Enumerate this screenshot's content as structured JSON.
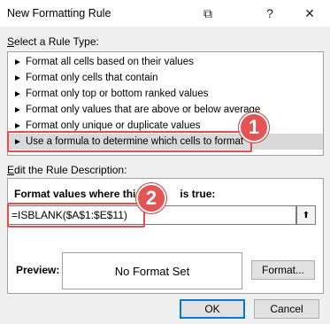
{
  "window": {
    "title": "New Formatting Rule",
    "controls": {
      "restore": "⧉",
      "help": "?",
      "close": "✕"
    }
  },
  "rule_type": {
    "label_prefix": "",
    "label_hot": "S",
    "label_rest": "elect a Rule Type:",
    "items": [
      {
        "label": "Format all cells based on their values",
        "selected": false
      },
      {
        "label": "Format only cells that contain",
        "selected": false
      },
      {
        "label": "Format only top or bottom ranked values",
        "selected": false
      },
      {
        "label": "Format only values that are above or below average",
        "selected": false
      },
      {
        "label": "Format only unique or duplicate values",
        "selected": false
      },
      {
        "label": "Use a formula to determine which cells to format",
        "selected": true
      }
    ],
    "arrow_glyph": "►"
  },
  "description": {
    "label_hot": "E",
    "label_rest": "dit the Rule Description:",
    "formula_heading": "Format values where this formula is true:",
    "formula_heading_visible": "Format values where this f",
    "formula_heading_tail": "is true:",
    "formula_value": "=ISBLANK($A$1:$E$11)",
    "collapse_glyph": "⬆",
    "preview_label": "Preview:",
    "preview_text": "No Format Set",
    "format_button": "Format..."
  },
  "annotations": {
    "badge_1": "1",
    "badge_2": "2",
    "highlight_color": "#e84c4c"
  },
  "footer": {
    "ok": "OK",
    "cancel": "Cancel"
  }
}
